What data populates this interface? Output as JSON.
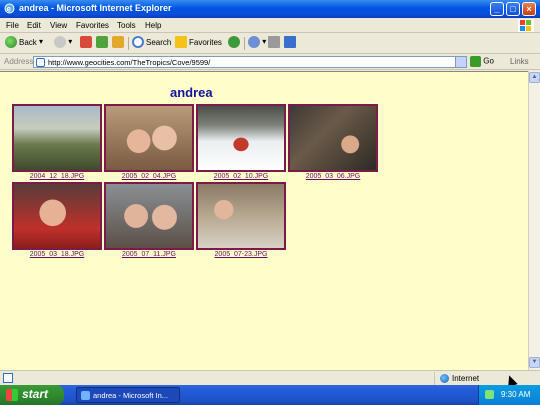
{
  "window": {
    "title": "andrea - Microsoft Internet Explorer"
  },
  "menu": [
    "File",
    "Edit",
    "View",
    "Favorites",
    "Tools",
    "Help"
  ],
  "toolbar": {
    "back": "Back",
    "search": "Search",
    "favorites": "Favorites"
  },
  "address": {
    "label": "Address",
    "url": "http://www.geocities.com/TheTropics/Cove/9599/",
    "go": "Go",
    "links": "Links"
  },
  "page": {
    "title": "andrea",
    "photos": [
      {
        "caption": "2004_12_18.JPG"
      },
      {
        "caption": "2005_02_04.JPG"
      },
      {
        "caption": "2005_02_10.JPG"
      },
      {
        "caption": "2005_03_06.JPG"
      },
      {
        "caption": "2005_03_18.JPG"
      },
      {
        "caption": "2005_07_11.JPG"
      },
      {
        "caption": "2005_07-23.JPG"
      }
    ]
  },
  "status": {
    "zone": "Internet"
  },
  "taskbar": {
    "start": "start",
    "task": "andrea - Microsoft In...",
    "clock": "9:30 AM"
  },
  "colors": {
    "page_bg": "#ffffcc",
    "title": "#14149c",
    "link": "#6a0a6a",
    "frame": "#7c1a4a"
  }
}
